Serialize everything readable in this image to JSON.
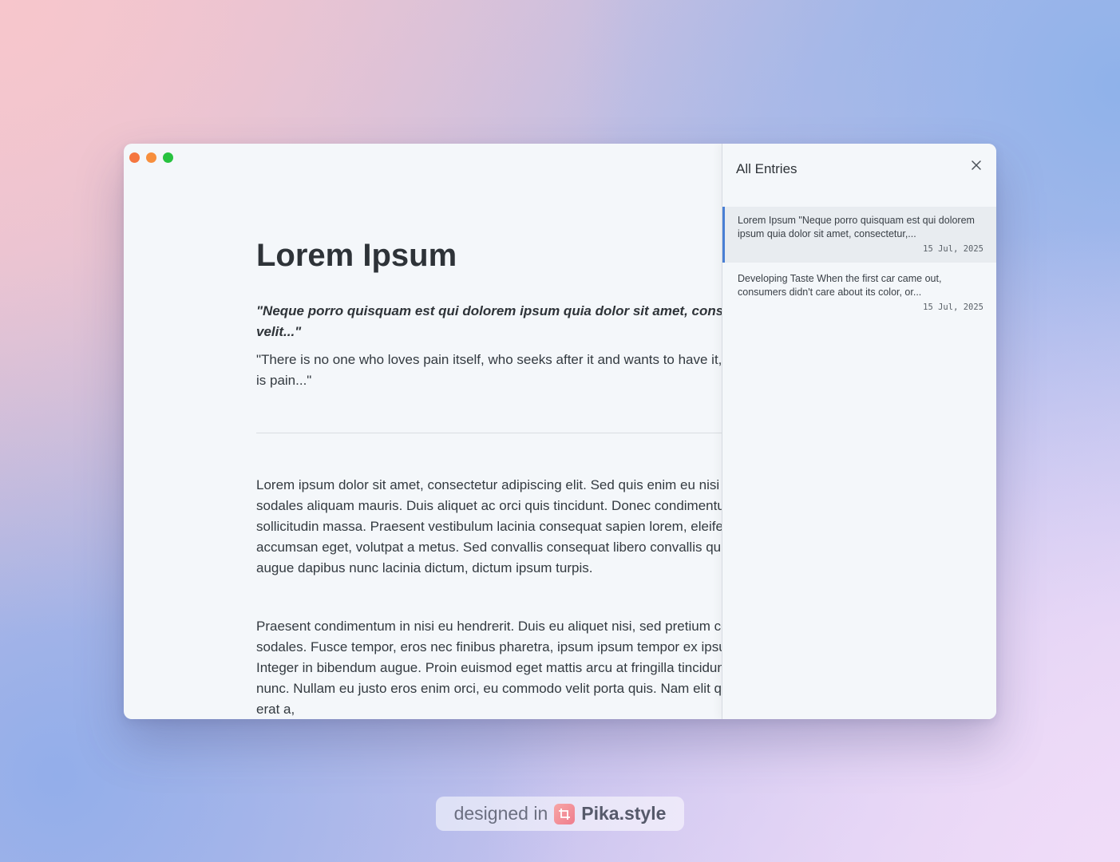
{
  "window": {
    "traffic_lights": {
      "close_color": "#f5763f",
      "minimize_color": "#f78f3d",
      "maximize_color": "#27c23f"
    }
  },
  "document": {
    "title": "Lorem Ipsum",
    "quote": "\"Neque porro quisquam est qui dolorem ipsum quia dolor sit amet, consectetur, adipisci velit...\"",
    "quote_translation": "\"There is no one who loves pain itself, who seeks after it and wants to have it, simply because it is pain...\"",
    "paragraphs": [
      "Lorem ipsum dolor sit amet, consectetur adipiscing elit. Sed quis enim eu nisi pellentesque sodales aliquam mauris. Duis aliquet ac orci quis tincidunt. Donec condimentum libero non, sollicitudin massa. Praesent vestibulum lacinia consequat sapien lorem, eleifend sit amet accumsan eget, volutpat a metus. Sed convallis consequat libero convallis quis. Cras quis augue dapibus nunc lacinia dictum, dictum ipsum turpis.",
      "Praesent condimentum in nisi eu hendrerit. Duis eu aliquet nisi, sed pretium condimentum sodales. Fusce tempor, eros nec finibus pharetra, ipsum ipsum tempor ex ipsum eu libero. Integer in bibendum augue. Proin euismod eget mattis arcu at fringilla tincidunt. In sit amet odio nunc. Nullam eu justo eros enim orci, eu commodo velit porta quis. Nam elit quam, euismod eu erat a,"
    ]
  },
  "entries_panel": {
    "title": "All Entries",
    "close_icon": "close-icon",
    "accent_color": "#4a7fd4",
    "entries": [
      {
        "text": "Lorem Ipsum \"Neque porro quisquam est qui dolorem ipsum quia dolor sit amet, consectetur,...",
        "date": "15 Jul, 2025",
        "selected": true
      },
      {
        "text": "Developing Taste When the first car came out, consumers didn't care about its color, or...",
        "date": "15 Jul, 2025",
        "selected": false
      }
    ]
  },
  "watermark": {
    "prefix": "designed in",
    "brand": "Pika.style",
    "logo_icon": "crop-icon"
  }
}
